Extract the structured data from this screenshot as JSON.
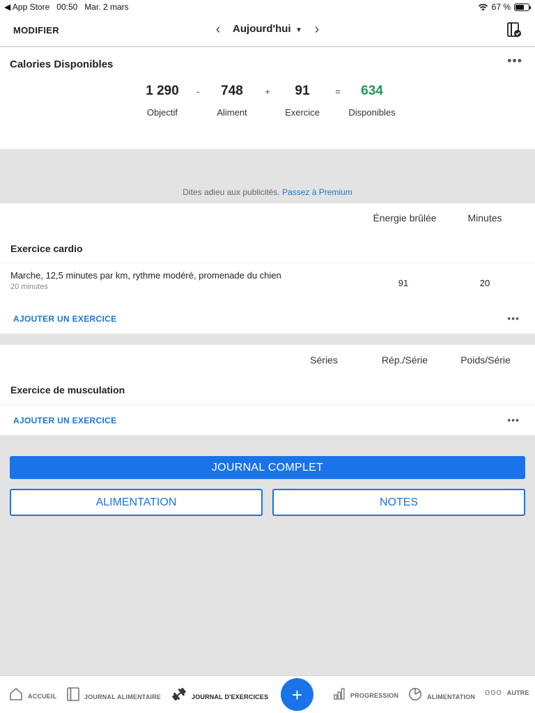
{
  "status_bar": {
    "carrier": "◀ App Store",
    "time": "00:50",
    "date": "Mar. 2 mars",
    "battery": "67 %"
  },
  "nav": {
    "modify": "MODIFIER",
    "date_label": "Aujourd'hui",
    "prev_icon": "chevron-left-icon",
    "next_icon": "chevron-right-icon"
  },
  "calories": {
    "title": "Calories Disponibles",
    "goal": {
      "value": "1 290",
      "label": "Objectif"
    },
    "food": {
      "value": "748",
      "label": "Aliment"
    },
    "exercise": {
      "value": "91",
      "label": "Exercice"
    },
    "remaining": {
      "value": "634",
      "label": "Disponibles"
    },
    "ops": {
      "minus": "-",
      "plus": "+",
      "equals": "="
    },
    "remaining_color": "#189a5a"
  },
  "ad": {
    "text": "Dites adieu aux publicités.",
    "link": "Passez à Premium"
  },
  "cardio": {
    "col_energy": "Énergie brûlée",
    "col_minutes": "Minutes",
    "title": "Exercice cardio",
    "entries": [
      {
        "name": "Marche, 12,5 minutes par km, rythme modéré, promenade du chien",
        "sub": "20 minutes",
        "energy": "91",
        "minutes": "20"
      }
    ],
    "add": "AJOUTER UN EXERCICE"
  },
  "strength": {
    "col_sets": "Séries",
    "col_reps": "Rép./Série",
    "col_weight": "Poids/Série",
    "title": "Exercice de musculation",
    "add": "AJOUTER UN EXERCICE"
  },
  "buttons": {
    "full_journal": "JOURNAL COMPLET",
    "food": "ALIMENTATION",
    "notes": "NOTES"
  },
  "tabs": [
    {
      "label": "ACCUEIL",
      "icon": "home-icon"
    },
    {
      "label": "JOURNAL ALIMENTAIRE",
      "icon": "book-icon"
    },
    {
      "label": "JOURNAL D'EXERCICES",
      "icon": "dumbbell-icon"
    },
    {
      "label": "PROGRESSION",
      "icon": "bar-chart-icon"
    },
    {
      "label": "ALIMENTATION",
      "icon": "pie-chart-icon"
    },
    {
      "label": "AUTRE",
      "icon": "more-icon"
    }
  ],
  "fab_label": "+",
  "colors": {
    "accent": "#1a73e8",
    "link": "#1976d2"
  }
}
